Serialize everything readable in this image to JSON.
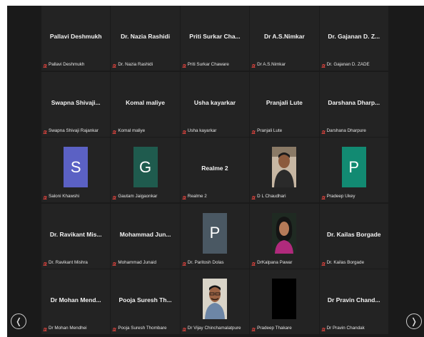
{
  "tiles": [
    {
      "center": "Pallavi Deshmukh",
      "plate": "Pallavi Deshmukh"
    },
    {
      "center": "Dr. Nazia Rashidi",
      "plate": "Dr. Nazia Rashidi"
    },
    {
      "center": "Priti Surkar Cha...",
      "plate": "Priti Surkar Chaware"
    },
    {
      "center": "Dr A.S.Nimkar",
      "plate": "Dr A.S.Nimkar"
    },
    {
      "center": "Dr. Gajanan D. Z...",
      "plate": "Dr. Gajanan D. ZADE"
    },
    {
      "center": "Swapna Shivaji...",
      "plate": "Swapna Shivaji Rajankar"
    },
    {
      "center": "Komal maliye",
      "plate": "Komal maliye"
    },
    {
      "center": "Usha kayarkar",
      "plate": "Usha kayarkar"
    },
    {
      "center": "Pranjali Lute",
      "plate": "Pranjali Lute"
    },
    {
      "center": "Darshana Dharp...",
      "plate": "Darshana Dharpure"
    },
    {
      "avatar": "S",
      "avatar_color": "#5b61c4",
      "plate": "Saloni Khawshi"
    },
    {
      "avatar": "G",
      "avatar_color": "#1f5b4e",
      "plate": "Gautam Jaigaonkar"
    },
    {
      "center": "Realme 2",
      "plate": "Realme 2"
    },
    {
      "photo": "man-photo",
      "plate": "D L Chaudhari"
    },
    {
      "avatar": "P",
      "avatar_color": "#128a72",
      "plate": "Pradeep Ukey"
    },
    {
      "center": "Dr. Ravikant Mis...",
      "plate": "Dr. Ravikant Mishra"
    },
    {
      "center": "Mohammad Jun...",
      "plate": "Mohammad Junaid"
    },
    {
      "avatar": "P",
      "avatar_color": "#4a5863",
      "plate": "Dr. Paritosh Dolas"
    },
    {
      "photo": "woman-photo",
      "plate": "DrKalpana Pawar"
    },
    {
      "center": "Dr. Kailas Borgade",
      "plate": "Dr. Kailas Borgade"
    },
    {
      "center": "Dr Mohan Mend...",
      "plate": "Dr Mohan Mendhei"
    },
    {
      "center": "Pooja Suresh Th...",
      "plate": "Pooja Suresh Thombare"
    },
    {
      "photo": "man-glasses-photo",
      "plate": "Dr Vijay Chinchamalatpure"
    },
    {
      "photo": "black-video",
      "plate": "Pradeep Thakare"
    },
    {
      "center": "Dr Pravin Chand...",
      "plate": "Dr Pravin Chandak"
    }
  ],
  "colors": {
    "background": "#1a1a1a",
    "tile": "#232323",
    "muted_mic": "#e0443e"
  },
  "nav": {
    "prev_icon": "chevron-left-icon",
    "next_icon": "chevron-right-icon",
    "prev_glyph": "❬",
    "next_glyph": "❭"
  }
}
